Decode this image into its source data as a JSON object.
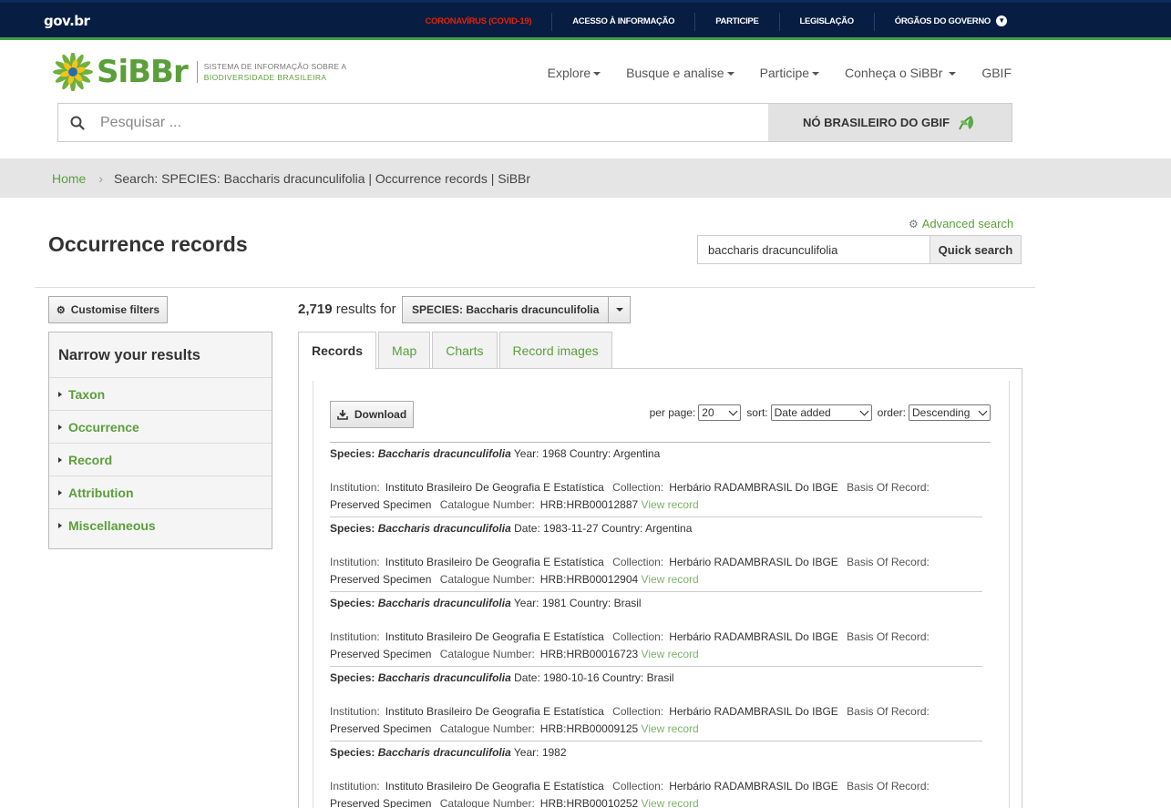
{
  "gov": {
    "logo": "gov.br",
    "links": [
      "CORONAVÍRUS (COVID-19)",
      "ACESSO À INFORMAÇÃO",
      "PARTICIPE",
      "LEGISLAÇÃO",
      "ÓRGÃOS DO GOVERNO"
    ],
    "covid_color": "#e52207"
  },
  "brand": {
    "name": "SiBBr",
    "tag_line1": "SISTEMA DE INFORMAÇÃO SOBRE A",
    "tag_line2": "BIODIVERSIDADE BRASILEIRA",
    "green": "#5a9f3a"
  },
  "nav": [
    "Explore",
    "Busque e analise",
    "Participe",
    "Conheça o SiBBr",
    "GBIF"
  ],
  "search": {
    "placeholder": "Pesquisar ...",
    "node_label": "NÓ BRASILEIRO DO GBIF"
  },
  "breadcrumb": {
    "home": "Home",
    "current": "Search: SPECIES: Baccharis dracunculifolia | Occurrence records | SiBBr"
  },
  "page": {
    "title": "Occurrence records",
    "advanced": "Advanced search",
    "quick_value": "baccharis dracunculifolia",
    "quick_button": "Quick search"
  },
  "sidebar": {
    "customise": "Customise filters",
    "heading": "Narrow your results",
    "facets": [
      "Taxon",
      "Occurrence",
      "Record",
      "Attribution",
      "Miscellaneous"
    ]
  },
  "results": {
    "count": "2,719",
    "count_suffix": "results for",
    "query": "SPECIES: Baccharis dracunculifolia",
    "tabs": [
      "Records",
      "Map",
      "Charts",
      "Record images"
    ],
    "download": "Download",
    "per_page_label": "per page:",
    "per_page": "20",
    "sort_label": "sort:",
    "sort": "Date added",
    "order_label": "order:",
    "order": "Descending"
  },
  "labels": {
    "species": "Species:",
    "institution": "Institution:",
    "collection": "Collection:",
    "basis": "Basis Of Record:",
    "catalogue": "Catalogue Number:",
    "view": "View record"
  },
  "records": [
    {
      "species": "Baccharis dracunculifolia",
      "when_label": "Year:",
      "when": "1968",
      "country_label": "Country:",
      "country": "Argentina",
      "institution": "Instituto Brasileiro De Geografia E Estatística",
      "collection": "Herbário RADAMBRASIL Do IBGE",
      "basis": "Preserved Specimen",
      "catalogue": "HRB:HRB00012887"
    },
    {
      "species": "Baccharis dracunculifolia",
      "when_label": "Date:",
      "when": "1983-11-27",
      "country_label": "Country:",
      "country": "Argentina",
      "institution": "Instituto Brasileiro De Geografia E Estatística",
      "collection": "Herbário RADAMBRASIL Do IBGE",
      "basis": "Preserved Specimen",
      "catalogue": "HRB:HRB00012904"
    },
    {
      "species": "Baccharis dracunculifolia",
      "when_label": "Year:",
      "when": "1981",
      "country_label": "Country:",
      "country": "Brasil",
      "institution": "Instituto Brasileiro De Geografia E Estatística",
      "collection": "Herbário RADAMBRASIL Do IBGE",
      "basis": "Preserved Specimen",
      "catalogue": "HRB:HRB00016723"
    },
    {
      "species": "Baccharis dracunculifolia",
      "when_label": "Date:",
      "when": "1980-10-16",
      "country_label": "Country:",
      "country": "Brasil",
      "institution": "Instituto Brasileiro De Geografia E Estatística",
      "collection": "Herbário RADAMBRASIL Do IBGE",
      "basis": "Preserved Specimen",
      "catalogue": "HRB:HRB00009125"
    },
    {
      "species": "Baccharis dracunculifolia",
      "when_label": "Year:",
      "when": "1982",
      "country_label": "",
      "country": "",
      "institution": "Instituto Brasileiro De Geografia E Estatística",
      "collection": "Herbário RADAMBRASIL Do IBGE",
      "basis": "Preserved Specimen",
      "catalogue": "HRB:HRB00010252"
    }
  ]
}
